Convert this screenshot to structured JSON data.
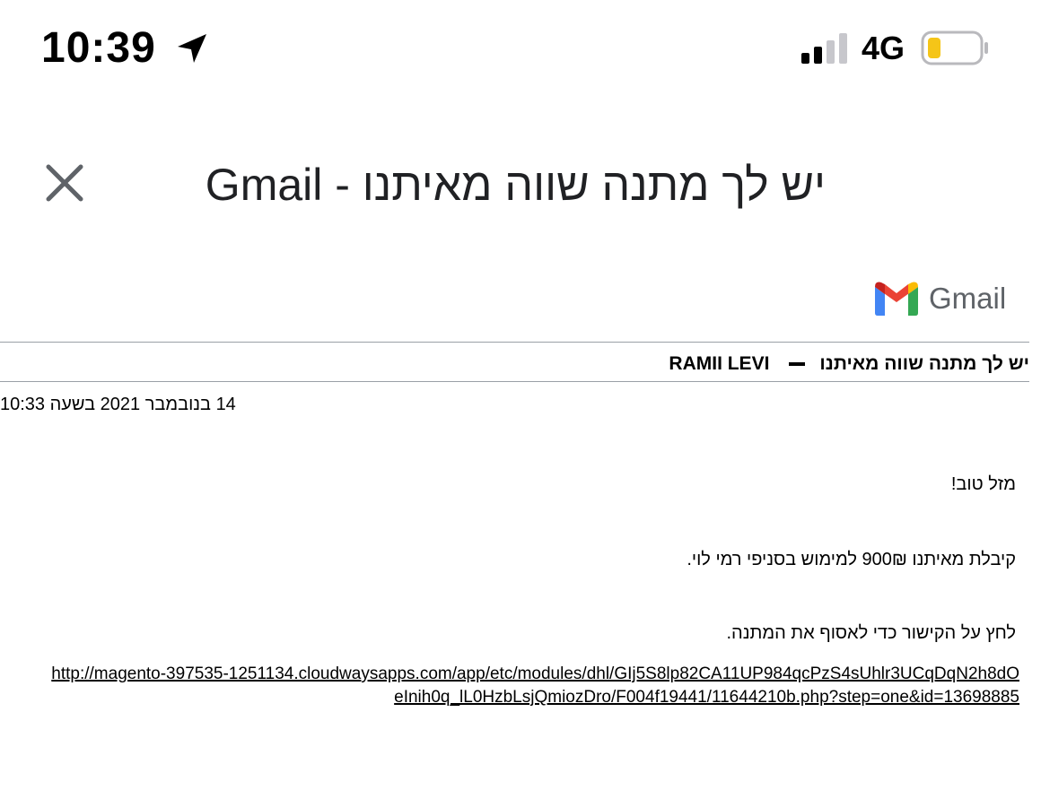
{
  "status_bar": {
    "time": "10:39",
    "network": "4G",
    "icons": [
      "location-arrow-icon",
      "signal-icon",
      "battery-icon"
    ],
    "battery_color": "#f5c518"
  },
  "title_bar": {
    "title": "יש לך מתנה שווה מאיתנו - Gmail",
    "close_icon": "close-icon"
  },
  "brand": {
    "logo_text": "Gmail",
    "colors": {
      "red": "#ea4335",
      "blue": "#4285f4",
      "green": "#34a853",
      "yellow": "#fbbc04"
    }
  },
  "email": {
    "subject": "יש לך מתנה שווה מאיתנו",
    "sender": "RAMII LEVI",
    "date": "14 בנובמבר 2021 בשעה 10:33",
    "greeting": "מזל טוב!",
    "offer": "קיבלת מאיתנו 900₪ למימוש בסניפי רמי לוי.",
    "instruction": "לחץ על הקישור כדי לאסוף את המתנה.",
    "link": "http://magento-397535-1251134.cloudwaysapps.com/app/etc/modules/dhl/GIj5S8lp82CA11UP984qcPzS4sUhlr3UCqDqN2h8dOeInih0q_lL0HzbLsjQmiozDro/F004f19441/11644210b.php?step=one&id=13698885"
  }
}
